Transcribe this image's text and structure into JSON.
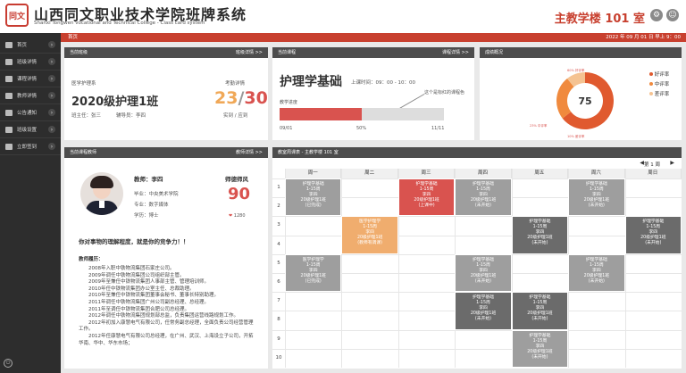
{
  "header": {
    "seal": "同文",
    "school_name": "山西同文职业技术学院班牌系统",
    "school_en": "Shanxi Tongwen vocational and Technical College - Class card system",
    "room": "主教学楼 101 室"
  },
  "topbar": {
    "home": "首页",
    "datetime": "2022 年 09 月 01 日  早上 9：00"
  },
  "sidebar": {
    "items": [
      {
        "label": "首页"
      },
      {
        "label": "班级详情"
      },
      {
        "label": "课程详情"
      },
      {
        "label": "教师详情"
      },
      {
        "label": "公告通知"
      },
      {
        "label": "班级设置"
      },
      {
        "label": "立即签到"
      }
    ]
  },
  "class_card": {
    "title": "当前班级",
    "link": "班级详情 >>",
    "major_label": "医学护理系",
    "class_name": "2020级护理1班",
    "head_teacher": "班主任：张三",
    "assistant": "辅导员：李四",
    "attendance_label": "考勤详情",
    "actual": "23",
    "total": "30",
    "actual_total_label": "实到 / 应到"
  },
  "course_card": {
    "title": "当前课程",
    "link": "课程详情 >>",
    "course_name": "护理学基础",
    "time": "上课时间：09：00 - 10：00",
    "progress_label": "教学进度",
    "annotation": "这个是标红的课程色",
    "start": "09/01",
    "pct": "50%",
    "end": "11/11",
    "progress_value": 0.5
  },
  "grade_card": {
    "title": "成绩概况",
    "center_value": "75",
    "legend": [
      {
        "label": "好评率",
        "color": "#e05a2f"
      },
      {
        "label": "中评率",
        "color": "#f08a3e"
      },
      {
        "label": "差评率",
        "color": "#f5c392"
      }
    ],
    "seg_labels": [
      "60% 好评率",
      "23% 中评率",
      "10% 差评率"
    ],
    "chart_data": {
      "type": "pie",
      "values": [
        60,
        23,
        10
      ],
      "categories": [
        "好评率",
        "中评率",
        "差评率"
      ]
    }
  },
  "teacher_card": {
    "title": "当前课程教师",
    "link": "教师详情 >>",
    "teacher": "教师：李四",
    "honor": "师德师风",
    "score": "90",
    "school": "毕业：中央美术学院",
    "major": "专业：数字媒体",
    "degree": "学历：博士",
    "likes": "1280",
    "motto": "你对事物的理解程度，就是你的竞争力！！",
    "history_title": "教师履历：",
    "history": [
      "2008年入职中铁物流集团石家庄公司。",
      "2009年调任中铁物流集团公司组织部主管。",
      "2009年至兼任中铁物流集团人事部主管、管理培训师。",
      "2010年任中铁物流集团办公室主任、总裁助理。",
      "2010年至兼任中铁物流集团董事会秘书、董事长特别助理。",
      "2011年调任中铁物流集团广州公司副总经理、总经理。",
      "2011年至调任中铁物流集团合肥公司总经理。",
      "2012年调任中铁物流集团规划部总监，负责集团运营线路规划工作。",
      "2012年初加入康慧电气有限公司，任常务副总经理，全面负责公司经营管理工作。",
      "2012年任康慧电气有限公司总经理，在广州、武汉、上海设立子公司，开拓华南、华中、华东市场；"
    ]
  },
  "schedule": {
    "title": "教室周课表 - 主教学楼 101 室",
    "week": "第 1 周",
    "days": [
      "周一",
      "周二",
      "周三",
      "周四",
      "周五",
      "周六",
      "周日"
    ],
    "periods": [
      "1",
      "2",
      "3",
      "4",
      "5",
      "6",
      "7",
      "8",
      "9",
      "10"
    ],
    "cells": [
      {
        "col": 0,
        "start": 1,
        "span": 2,
        "color": "#9e9e9e",
        "lines": [
          "护理学基础",
          "1-15周",
          "李四",
          "20级护理1班",
          "(已完成)"
        ]
      },
      {
        "col": 2,
        "start": 1,
        "span": 2,
        "color": "#d9534f",
        "lines": [
          "护理学基础",
          "1-15周",
          "李四",
          "20级护理1班",
          "(上课中)"
        ]
      },
      {
        "col": 3,
        "start": 1,
        "span": 2,
        "color": "#9e9e9e",
        "lines": [
          "护理学基础",
          "1-15周",
          "李四",
          "20级护理1班",
          "(未开始)"
        ]
      },
      {
        "col": 5,
        "start": 1,
        "span": 2,
        "color": "#9e9e9e",
        "lines": [
          "护理学基础",
          "1-15周",
          "李四",
          "20级护理1班",
          "(未开始)"
        ]
      },
      {
        "col": 1,
        "start": 3,
        "span": 2,
        "color": "#f0ad6e",
        "lines": [
          "医学护理学",
          "1-15周",
          "李四",
          "20级护理1班",
          "(教师有调课)"
        ]
      },
      {
        "col": 4,
        "start": 3,
        "span": 2,
        "color": "#6b6b6b",
        "lines": [
          "护理学基础",
          "1-15周",
          "李四",
          "20级护理1班",
          "(未开始)"
        ]
      },
      {
        "col": 6,
        "start": 3,
        "span": 2,
        "color": "#6b6b6b",
        "lines": [
          "护理学基础",
          "1-15周",
          "李四",
          "20级护理1班",
          "(未开始)"
        ]
      },
      {
        "col": 0,
        "start": 5,
        "span": 2,
        "color": "#9e9e9e",
        "lines": [
          "医学护理学",
          "1-15周",
          "李四",
          "20级护理1班",
          "(已完成)"
        ]
      },
      {
        "col": 3,
        "start": 5,
        "span": 2,
        "color": "#9e9e9e",
        "lines": [
          "护理学基础",
          "1-15周",
          "李四",
          "20级护理1班",
          "(未开始)"
        ]
      },
      {
        "col": 5,
        "start": 5,
        "span": 2,
        "color": "#9e9e9e",
        "lines": [
          "护理学基础",
          "1-15周",
          "李四",
          "20级护理1班",
          "(未开始)"
        ]
      },
      {
        "col": 3,
        "start": 7,
        "span": 2,
        "color": "#6b6b6b",
        "lines": [
          "护理学基础",
          "1-15周",
          "李四",
          "20级护理1班",
          "(未开始)"
        ]
      },
      {
        "col": 4,
        "start": 7,
        "span": 2,
        "color": "#6b6b6b",
        "lines": [
          "护理学基础",
          "1-15周",
          "李四",
          "20级护理1班",
          "(未开始)"
        ]
      },
      {
        "col": 4,
        "start": 9,
        "span": 2,
        "color": "#9e9e9e",
        "lines": [
          "护理学基础",
          "1-15周",
          "李四",
          "20级护理1班",
          "(未开始)"
        ]
      }
    ]
  },
  "icons": [
    "gear-icon",
    "user-settings-icon",
    "home-icon",
    "power-icon"
  ]
}
